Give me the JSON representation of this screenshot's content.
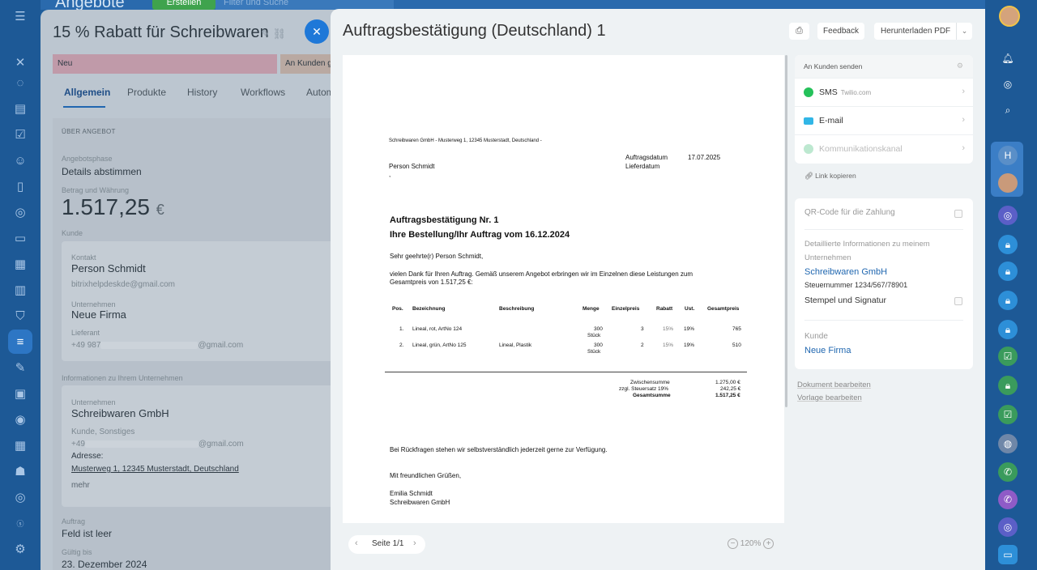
{
  "topbar": {
    "title": "Angebote",
    "create_label": "Erstellen",
    "search_placeholder": "Filter und Suche"
  },
  "deal": {
    "title": "15 % Rabatt für Schreibwaren",
    "stage_current": "Neu",
    "stage_next": "An Kunden g",
    "tabs": [
      {
        "label": "Allgemein"
      },
      {
        "label": "Produkte"
      },
      {
        "label": "History"
      },
      {
        "label": "Workflows"
      },
      {
        "label": "Autom"
      }
    ],
    "section_about": "ÜBER ANGEBOT",
    "phase_label": "Angebotsphase",
    "phase_value": "Details abstimmen",
    "amount_label": "Betrag und Währung",
    "amount_value": "1.517,25",
    "amount_currency": "€",
    "client_label": "Kunde",
    "contact_label": "Kontakt",
    "contact_name": "Person Schmidt",
    "contact_email": "bitrixhelpdeskde@gmail.com",
    "company_label": "Unternehmen",
    "company_name": "Neue Firma",
    "supplier_label": "Lieferant",
    "supplier_phone": "+49 987",
    "supplier_email_suffix": "@gmail.com",
    "section_company": "Informationen zu Ihrem Unternehmen",
    "own_company_label": "Unternehmen",
    "own_company_name": "Schreibwaren GmbH",
    "own_company_sub": "Kunde, Sonstiges",
    "own_company_phone": "+49",
    "own_company_email_suffix": "@gmail.com",
    "address_label": "Adresse:",
    "address_value": "Musterweg 1, 12345 Musterstadt, Deutschland",
    "more_label": "mehr",
    "order_label": "Auftrag",
    "order_value": "Feld ist leer",
    "valid_label": "Gültig bis",
    "valid_value": "23. Dezember 2024"
  },
  "slider": {
    "title": "Auftragsbestätigung (Deutschland) 1",
    "feedback_label": "Feedback",
    "download_label": "Herunterladen PDF",
    "page_label": "Seite 1/1",
    "zoom_label": "120%"
  },
  "document": {
    "sender_line": "Schreibwaren GmbH -  Musterweg 1, 12345 Musterstadt, Deutschland -",
    "recipient": "Person Schmidt",
    "recipient_extra": ",",
    "order_date_label": "Auftragsdatum",
    "order_date_value": "17.07.2025",
    "delivery_date_label": "Lieferdatum",
    "heading1": "Auftragsbestätigung Nr. 1",
    "heading2": "Ihre Bestellung/Ihr Auftrag vom 16.12.2024",
    "salutation": "Sehr geehrte(r) Person Schmidt,",
    "intro_line1": "vielen Dank für Ihren Auftrag. Gemäß unserem Angebot erbringen wir im Einzelnen diese Leistungen zum",
    "intro_line2": "Gesamtpreis von 1.517,25 €:",
    "table_headers": {
      "pos": "Pos.",
      "name": "Bezeichnung",
      "desc": "Beschreibung",
      "qty": "Menge",
      "unit_price": "Einzelpreis",
      "discount": "Rabatt",
      "tax": "Ust.",
      "total": "Gesamtpreis"
    },
    "rows": [
      {
        "pos": "1.",
        "name": "Lineal, rot, ArtNo 124",
        "desc": "",
        "qty": "300",
        "unit": "Stück",
        "price": "3",
        "discount": "15%",
        "tax": "19%",
        "total": "765"
      },
      {
        "pos": "2.",
        "name": "Lineal, grün, ArtNo 125",
        "desc": "Lineal, Plastik",
        "qty": "300",
        "unit": "Stück",
        "price": "2",
        "discount": "15%",
        "tax": "19%",
        "total": "510"
      }
    ],
    "subtotal_label": "Zwischensumme",
    "subtotal_value": "1.275,00 €",
    "tax_label": "zzgl. Steuersatz 19%",
    "tax_value": "242,25 €",
    "grand_total_label": "Gesamtsumme",
    "grand_total_value": "1.517,25 €",
    "closing_note": "Bei Rückfragen stehen wir selbstverständlich jederzeit gerne zur Verfügung.",
    "regards": "Mit freundlichen Grüßen,",
    "signer_name": "Emilia Schmidt",
    "signer_company": "Schreibwaren GmbH"
  },
  "send": {
    "header": "An Kunden senden",
    "sms_label": "SMS",
    "sms_provider": "Twilio.com",
    "email_label": "E-mail",
    "channel_label": "Kommunikationskanal",
    "copy_link_label": "Link kopieren"
  },
  "settings": {
    "qr_label": "QR-Code für die Zahlung",
    "company_info_label_line1": "Detaillierte Informationen zu meinem",
    "company_info_label_line2": "Unternehmen",
    "company_name": "Schreibwaren GmbH",
    "tax_number": "Steuernummer 1234/567/78901",
    "stamp_label": "Stempel und Signatur",
    "client_label": "Kunde",
    "client_name": "Neue Firma"
  },
  "footer_links": {
    "edit_document": "Dokument bearbeiten",
    "edit_template": "Vorlage bearbeiten"
  },
  "colors": {
    "accent": "#2067b0",
    "sidebar": "#1d5996",
    "panel_bg": "#eef2f4",
    "sms_green": "#25c15a",
    "email_blue": "#31b6e6"
  }
}
